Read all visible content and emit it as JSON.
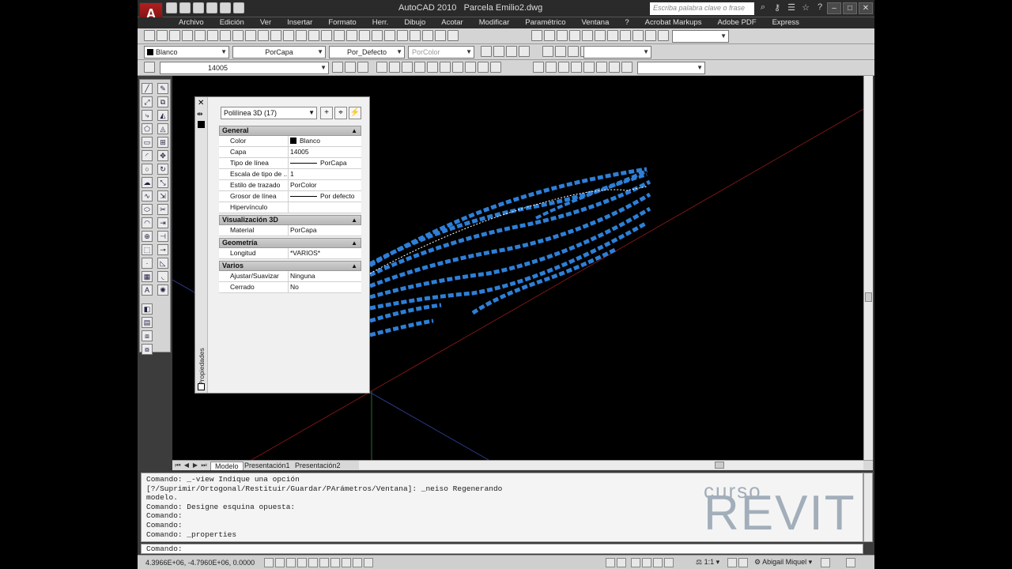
{
  "app": {
    "title": "AutoCAD 2010",
    "file": "Parcela Emilio2.dwg",
    "logo": "A",
    "search_placeholder": "Escriba palabra clave o frase"
  },
  "menu": [
    "Archivo",
    "Edición",
    "Ver",
    "Insertar",
    "Formato",
    "Herr.",
    "Dibujo",
    "Acotar",
    "Modificar",
    "Paramétrico",
    "Ventana",
    "?",
    "Acrobat Markups",
    "Adobe PDF",
    "Express"
  ],
  "props_toolbar": {
    "color": "Blanco",
    "linetype": "PorCapa",
    "lineweight": "Por_Defecto",
    "plotstyle": "PorColor"
  },
  "layer_toolbar": {
    "layer": "14005"
  },
  "properties": {
    "panel_label": "Propiedades",
    "object": "Polilínea 3D (17)",
    "categories": [
      {
        "name": "General",
        "rows": [
          {
            "k": "Color",
            "v": "Blanco",
            "type": "color"
          },
          {
            "k": "Capa",
            "v": "14005"
          },
          {
            "k": "Tipo de línea",
            "v": "PorCapa",
            "type": "line"
          },
          {
            "k": "Escala de tipo de ...",
            "v": "1"
          },
          {
            "k": "Estilo de trazado",
            "v": "PorColor"
          },
          {
            "k": "Grosor de línea",
            "v": "Por defecto",
            "type": "line"
          },
          {
            "k": "Hipervínculo",
            "v": ""
          }
        ]
      },
      {
        "name": "Visualización 3D",
        "rows": [
          {
            "k": "Material",
            "v": "PorCapa"
          }
        ]
      },
      {
        "name": "Geometría",
        "rows": [
          {
            "k": "Longitud",
            "v": "*VARIOS*"
          }
        ]
      },
      {
        "name": "Varios",
        "rows": [
          {
            "k": "Ajustar/Suavizar",
            "v": "Ninguna"
          },
          {
            "k": "Cerrado",
            "v": "No"
          }
        ]
      }
    ]
  },
  "layout_tabs": [
    "Modelo",
    "Presentación1",
    "Presentación2"
  ],
  "command_history": [
    "Comando: _-view Indique una opción",
    "[?/Suprimir/Ortogonal/Restituir/Guardar/PArámetros/Ventana]: _neiso Regenerando",
    "modelo.",
    "Comando: Designe esquina opuesta:",
    "Comando:",
    "Comando:",
    "Comando: _properties"
  ],
  "command_prompt": "Comando:",
  "watermark": {
    "line1": "curso",
    "line2": "REVIT"
  },
  "status": {
    "coords": "4.3966E+06, -4.7960E+06, 0.0000",
    "scale": "1:1",
    "workspace": "Abigail Miquel"
  },
  "colors": {
    "contours": "#2e7fd6",
    "window_bg": "#3c3c3c",
    "viewport": "#000000"
  }
}
